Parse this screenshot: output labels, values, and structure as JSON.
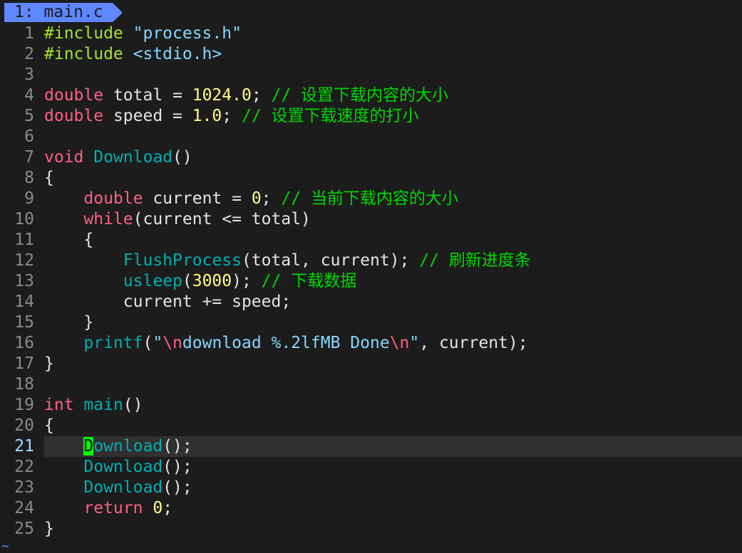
{
  "tab": {
    "label": "1: main.c"
  },
  "current_line": 21,
  "cursor": {
    "line": 21,
    "col": 0
  },
  "colors": {
    "background": "#1c1c1c",
    "tab_background": "#5f87ff",
    "keyword": "#ff5f87",
    "preprocessor": "#a6e22e",
    "string": "#87d7ff",
    "number": "#ffff87",
    "comment": "#00d700",
    "function": "#00afaf",
    "cursor": "#00ff00"
  },
  "lines": [
    {
      "n": "1",
      "tokens": [
        {
          "t": "#include ",
          "c": "pp"
        },
        {
          "t": "\"process.h\"",
          "c": "str"
        }
      ]
    },
    {
      "n": "2",
      "tokens": [
        {
          "t": "#include ",
          "c": "pp"
        },
        {
          "t": "<stdio.h>",
          "c": "str"
        }
      ]
    },
    {
      "n": "3",
      "tokens": []
    },
    {
      "n": "4",
      "tokens": [
        {
          "t": "double",
          "c": "kw"
        },
        {
          "t": " total = ",
          "c": "pl"
        },
        {
          "t": "1024.0",
          "c": "num"
        },
        {
          "t": "; ",
          "c": "pl"
        },
        {
          "t": "// 设置下载内容的大小",
          "c": "cm"
        }
      ]
    },
    {
      "n": "5",
      "tokens": [
        {
          "t": "double",
          "c": "kw"
        },
        {
          "t": " speed = ",
          "c": "pl"
        },
        {
          "t": "1.0",
          "c": "num"
        },
        {
          "t": "; ",
          "c": "pl"
        },
        {
          "t": "// 设置下载速度的打小",
          "c": "cm"
        }
      ]
    },
    {
      "n": "6",
      "tokens": []
    },
    {
      "n": "7",
      "tokens": [
        {
          "t": "void",
          "c": "kw"
        },
        {
          "t": " ",
          "c": "pl"
        },
        {
          "t": "Download",
          "c": "fn"
        },
        {
          "t": "()",
          "c": "pl"
        }
      ]
    },
    {
      "n": "8",
      "tokens": [
        {
          "t": "{",
          "c": "pl"
        }
      ]
    },
    {
      "n": "9",
      "tokens": [
        {
          "t": "    ",
          "c": "pl"
        },
        {
          "t": "double",
          "c": "kw"
        },
        {
          "t": " current = ",
          "c": "pl"
        },
        {
          "t": "0",
          "c": "num"
        },
        {
          "t": "; ",
          "c": "pl"
        },
        {
          "t": "// 当前下载内容的大小",
          "c": "cm"
        }
      ]
    },
    {
      "n": "10",
      "tokens": [
        {
          "t": "    ",
          "c": "pl"
        },
        {
          "t": "while",
          "c": "kw"
        },
        {
          "t": "(current <= total)",
          "c": "pl"
        }
      ]
    },
    {
      "n": "11",
      "tokens": [
        {
          "t": "    {",
          "c": "pl"
        }
      ]
    },
    {
      "n": "12",
      "tokens": [
        {
          "t": "        ",
          "c": "pl"
        },
        {
          "t": "FlushProcess",
          "c": "fn"
        },
        {
          "t": "(total, current); ",
          "c": "pl"
        },
        {
          "t": "// 刷新进度条",
          "c": "cm"
        }
      ]
    },
    {
      "n": "13",
      "tokens": [
        {
          "t": "        ",
          "c": "pl"
        },
        {
          "t": "usleep",
          "c": "fn"
        },
        {
          "t": "(",
          "c": "pl"
        },
        {
          "t": "3000",
          "c": "num"
        },
        {
          "t": "); ",
          "c": "pl"
        },
        {
          "t": "// 下载数据",
          "c": "cm"
        }
      ]
    },
    {
      "n": "14",
      "tokens": [
        {
          "t": "        current += speed;",
          "c": "pl"
        }
      ]
    },
    {
      "n": "15",
      "tokens": [
        {
          "t": "    }",
          "c": "pl"
        }
      ]
    },
    {
      "n": "16",
      "tokens": [
        {
          "t": "    ",
          "c": "pl"
        },
        {
          "t": "printf",
          "c": "fn"
        },
        {
          "t": "(",
          "c": "pl"
        },
        {
          "t": "\"",
          "c": "str"
        },
        {
          "t": "\\n",
          "c": "esc"
        },
        {
          "t": "download %.2lfMB Done",
          "c": "str"
        },
        {
          "t": "\\n",
          "c": "esc"
        },
        {
          "t": "\"",
          "c": "str"
        },
        {
          "t": ", current);",
          "c": "pl"
        }
      ]
    },
    {
      "n": "17",
      "tokens": [
        {
          "t": "}",
          "c": "pl"
        }
      ]
    },
    {
      "n": "18",
      "tokens": []
    },
    {
      "n": "19",
      "tokens": [
        {
          "t": "int",
          "c": "kw"
        },
        {
          "t": " ",
          "c": "pl"
        },
        {
          "t": "main",
          "c": "fn"
        },
        {
          "t": "()",
          "c": "pl"
        }
      ]
    },
    {
      "n": "20",
      "tokens": [
        {
          "t": "{",
          "c": "pl"
        }
      ]
    },
    {
      "n": "21",
      "tokens": [
        {
          "t": "    ",
          "c": "pl"
        },
        {
          "t": "D",
          "c": "cursor"
        },
        {
          "t": "ownload",
          "c": "fn"
        },
        {
          "t": "();",
          "c": "pl"
        }
      ]
    },
    {
      "n": "22",
      "tokens": [
        {
          "t": "    ",
          "c": "pl"
        },
        {
          "t": "Download",
          "c": "fn"
        },
        {
          "t": "();",
          "c": "pl"
        }
      ]
    },
    {
      "n": "23",
      "tokens": [
        {
          "t": "    ",
          "c": "pl"
        },
        {
          "t": "Download",
          "c": "fn"
        },
        {
          "t": "();",
          "c": "pl"
        }
      ]
    },
    {
      "n": "24",
      "tokens": [
        {
          "t": "    ",
          "c": "pl"
        },
        {
          "t": "return",
          "c": "kw"
        },
        {
          "t": " ",
          "c": "pl"
        },
        {
          "t": "0",
          "c": "num"
        },
        {
          "t": ";",
          "c": "pl"
        }
      ]
    },
    {
      "n": "25",
      "tokens": [
        {
          "t": "}",
          "c": "pl"
        }
      ]
    }
  ],
  "empty_line_marker": "~"
}
